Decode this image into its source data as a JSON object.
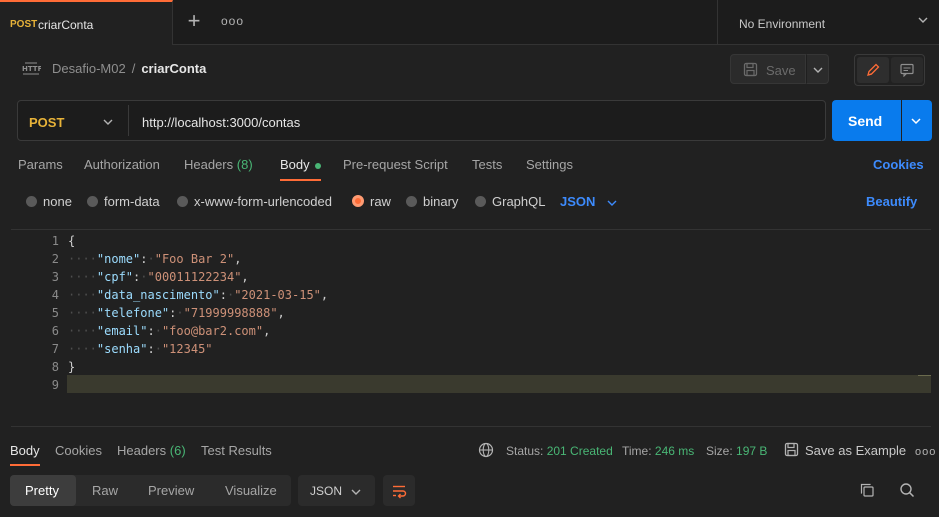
{
  "tab": {
    "method": "POST",
    "name": "criarConta"
  },
  "environment": {
    "label": "No Environment"
  },
  "breadcrumb": {
    "parent": "Desafio-M02",
    "separator": "/",
    "current": "criarConta"
  },
  "toolbar": {
    "save_label": "Save"
  },
  "request": {
    "method": "POST",
    "url": "http://localhost:3000/contas",
    "send_label": "Send"
  },
  "request_tabs": [
    {
      "label": "Params"
    },
    {
      "label": "Authorization"
    },
    {
      "label": "Headers",
      "count": "(8)"
    },
    {
      "label": "Body"
    },
    {
      "label": "Pre-request Script"
    },
    {
      "label": "Tests"
    },
    {
      "label": "Settings"
    }
  ],
  "cookies_label": "Cookies",
  "body_modes": [
    {
      "label": "none"
    },
    {
      "label": "form-data"
    },
    {
      "label": "x-www-form-urlencoded"
    },
    {
      "label": "raw"
    },
    {
      "label": "binary"
    },
    {
      "label": "GraphQL"
    }
  ],
  "body_format": "JSON",
  "beautify_label": "Beautify",
  "editor": {
    "line_numbers": [
      "1",
      "2",
      "3",
      "4",
      "5",
      "6",
      "7",
      "8",
      "9"
    ],
    "open_brace": "{",
    "close_brace": "}",
    "fields": [
      {
        "key": "\"nome\"",
        "value": "\"Foo Bar 2\""
      },
      {
        "key": "\"cpf\"",
        "value": "\"00011122234\""
      },
      {
        "key": "\"data_nascimento\"",
        "value": "\"2021-03-15\""
      },
      {
        "key": "\"telefone\"",
        "value": "\"71999998888\""
      },
      {
        "key": "\"email\"",
        "value": "\"foo@bar2.com\""
      },
      {
        "key": "\"senha\"",
        "value": "\"12345\""
      }
    ]
  },
  "response_tabs": [
    {
      "label": "Body"
    },
    {
      "label": "Cookies"
    },
    {
      "label": "Headers",
      "count": "(6)"
    },
    {
      "label": "Test Results"
    }
  ],
  "response_status": {
    "status_label": "Status:",
    "status_value": "201 Created",
    "time_label": "Time:",
    "time_value": "246 ms",
    "size_label": "Size:",
    "size_value": "197 B",
    "save_example_label": "Save as Example"
  },
  "response_formats": [
    {
      "label": "Pretty"
    },
    {
      "label": "Raw"
    },
    {
      "label": "Preview"
    },
    {
      "label": "Visualize"
    }
  ],
  "response_format_select": "JSON",
  "colors": {
    "accent": "#ff6c37",
    "primary": "#097bed",
    "method": "#e8b339",
    "success": "#49b675",
    "link": "#3d8bfd"
  }
}
